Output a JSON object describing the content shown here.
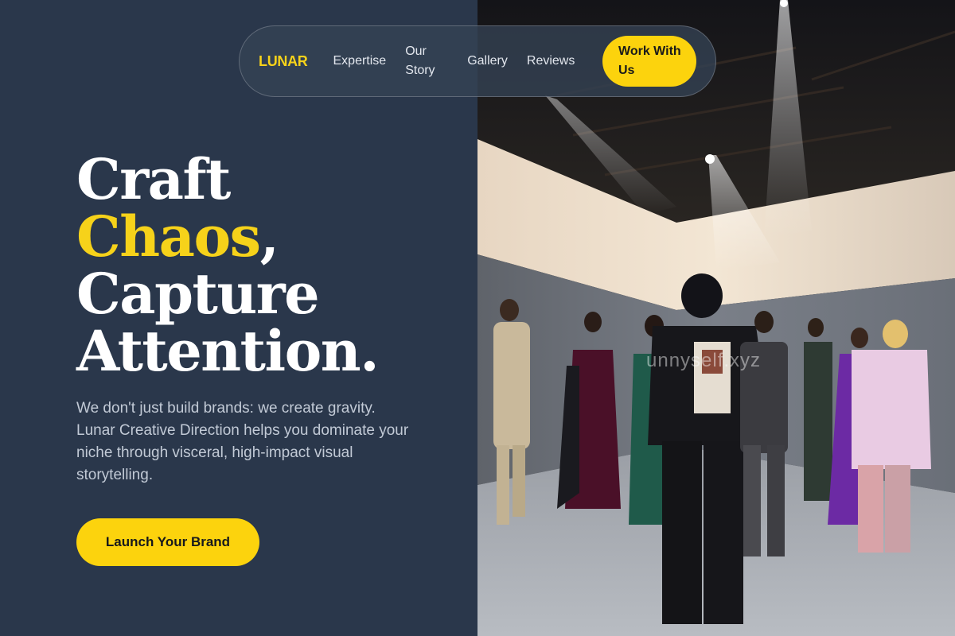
{
  "nav": {
    "brand": "LUNAR",
    "links": [
      "Expertise",
      "Our Story",
      "Gallery",
      "Reviews"
    ],
    "cta": "Work With Us"
  },
  "hero": {
    "headline_line1": "Craft",
    "headline_accent": "Chaos",
    "headline_comma": ",",
    "headline_line3": "Capture",
    "headline_line4": "Attention.",
    "subtext": "We don't just build brands: we create gravity. Lunar Creative Direction helps you dominate your niche through visceral, high-impact visual storytelling.",
    "cta": "Launch Your Brand"
  },
  "photo": {
    "watermark": "unnyself.xyz"
  },
  "colors": {
    "background": "#2a374b",
    "accent": "#fcd30d",
    "text": "#ffffff",
    "muted_text": "#c2cad6"
  }
}
